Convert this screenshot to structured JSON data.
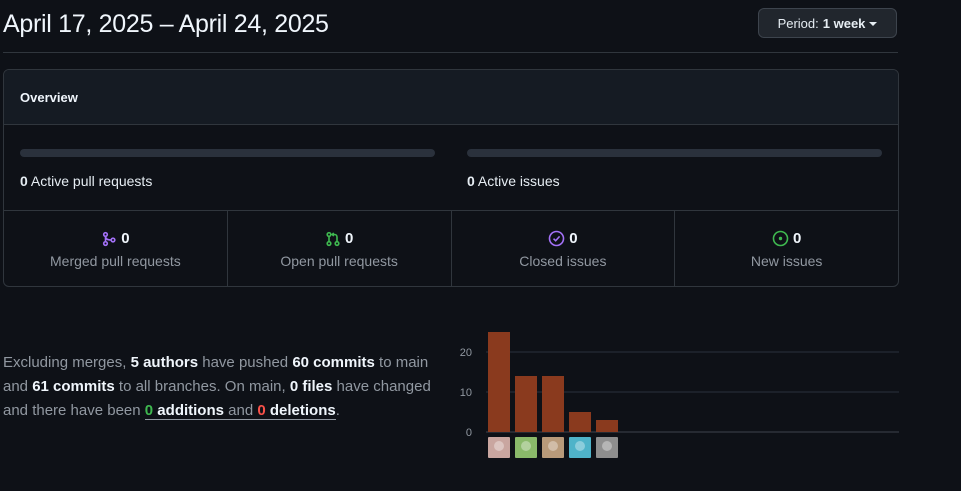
{
  "header": {
    "date_range": "April 17, 2025 – April 24, 2025",
    "period_prefix": "Period:",
    "period_value": "1 week"
  },
  "overview": {
    "title": "Overview",
    "active_prs_count": "0",
    "active_prs_label": "Active pull requests",
    "active_issues_count": "0",
    "active_issues_label": "Active issues",
    "stats": [
      {
        "icon": "merge-icon",
        "color": "#a371f7",
        "value": "0",
        "label": "Merged pull requests"
      },
      {
        "icon": "pull-request-icon",
        "color": "#3fb950",
        "value": "0",
        "label": "Open pull requests"
      },
      {
        "icon": "issue-closed-icon",
        "color": "#a371f7",
        "value": "0",
        "label": "Closed issues"
      },
      {
        "icon": "issue-opened-icon",
        "color": "#3fb950",
        "value": "0",
        "label": "New issues"
      }
    ]
  },
  "summary": {
    "t1": "Excluding merges, ",
    "authors": "5 authors",
    "t2": " have pushed ",
    "commits_main": "60 commits",
    "t3": " to main and ",
    "commits_all": "61 commits",
    "t4": " to all branches. On main, ",
    "files": "0 files",
    "t5": " have changed and there have been ",
    "additions_num": "0",
    "additions_word": " additions",
    "t6": " and ",
    "deletions_num": "0",
    "deletions_word": " deletions",
    "t7": "."
  },
  "chart_data": {
    "type": "bar",
    "categories": [
      "author-1",
      "author-2",
      "author-3",
      "author-4",
      "author-5"
    ],
    "values": [
      25,
      14,
      14,
      5,
      3
    ],
    "yticks": [
      0,
      10,
      20
    ],
    "ylim": [
      0,
      25
    ],
    "grid": true,
    "bar_color": "#8a3a1e",
    "avatar_colors": [
      "#c9a6a0",
      "#8ab96a",
      "#b89a7a",
      "#4fb3c9",
      "#8e8e8e"
    ]
  }
}
